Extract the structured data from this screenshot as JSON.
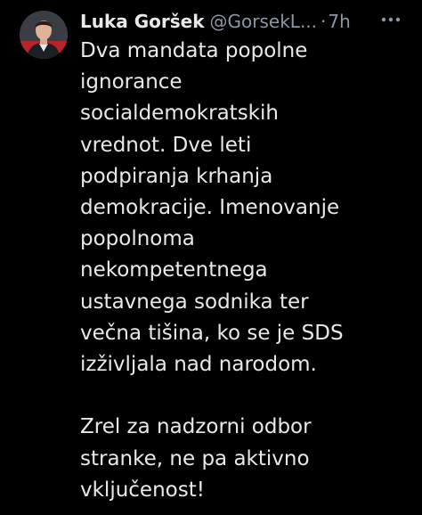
{
  "tweet": {
    "author": {
      "display_name": "Luka Goršek",
      "handle": "@GorsekL...",
      "separator": "·",
      "time": "7h"
    },
    "text_lines": [
      "Dva mandata popolne",
      "ignorance",
      "socialdemokratskih",
      "vrednot. Dve leti",
      "podpiranja krhanja",
      "demokracije. Imenovanje",
      "popolnoma",
      "nekompetentnega",
      "ustavnega sodnika ter",
      "večna tišina, ko se je SDS",
      "izživljala nad narodom.",
      "",
      "Zrel za nadzorni odbor",
      "stranke, ne pa aktivno",
      "vključenost!"
    ],
    "more_icon": "more-horizontal-icon"
  },
  "colors": {
    "background": "#000000",
    "text_primary": "#e7e9ea",
    "text_secondary": "#8b98a5"
  }
}
